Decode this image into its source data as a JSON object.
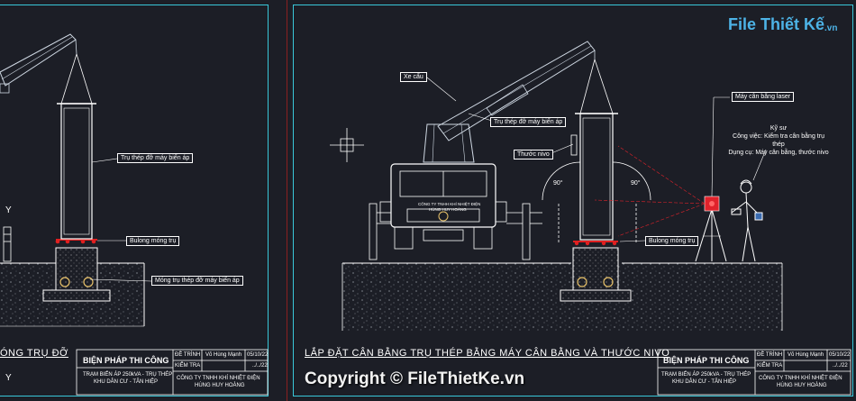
{
  "logo": {
    "main": "File Thiết Kế",
    "suffix": ".vn"
  },
  "watermark": "Copyright © FileThietKe.vn",
  "left_sheet": {
    "callouts": {
      "steel_post": "Trụ thép đỡ máy biến áp",
      "bolt": "Bulong móng trụ",
      "foundation": "Móng trụ thép đỡ máy biến áp"
    },
    "title_fragment": "ÓNG TRỤ ĐỠ",
    "axis_y": "Y",
    "axis_y_bottom": "Y"
  },
  "right_sheet": {
    "title": "LẮP ĐẶT CÂN BẰNG TRỤ THÉP BẰNG MÁY CÂN BẰNG VÀ THƯỚC NIVO",
    "callouts": {
      "crane": "Xe cẩu",
      "steel_post": "Trụ thép đỡ máy biến áp",
      "level_ruler": "Thước nivo",
      "laser": "Máy cân bằng laser",
      "bolt": "Bulong móng trụ"
    },
    "engineer": {
      "title": "Kỹ sư",
      "task": "Công việc: Kiểm tra cân bằng trụ thép",
      "tools": "Dụng cụ: Máy cân bằng, thước nivo"
    },
    "angle_left": "90°",
    "angle_right": "90°",
    "truck_text_1": "CÔNG TY TNHH KHÍ NHIỆT ĐIỆN",
    "truck_text_2": "HÙNG HUY HOÀNG"
  },
  "title_block": {
    "heading": "BIỆN PHÁP THI CÔNG",
    "project_line1": "TRẠM BIẾN ÁP 250kVA - TRỤ THÉP",
    "project_line2": "KHU DÂN CƯ - TÂN HIỆP",
    "row1_label": "ĐỀ TRÌNH",
    "row1_name": "Võ Hùng Mạnh",
    "row1_date": "05/10/22",
    "row2_label": "KIỂM TRA",
    "row2_date": "../../22",
    "company_line1": "CÔNG TY TNHH KHÍ NHIỆT ĐIỆN",
    "company_line2": "HÙNG HUY HOÀNG"
  },
  "colors": {
    "background": "#1c1e26",
    "border": "#39c7d9",
    "line": "#ffffff",
    "crane": "#cfd8e3",
    "laser": "#e0222b",
    "bolt_marker": "#e02020",
    "logo": "#4db3e6"
  }
}
